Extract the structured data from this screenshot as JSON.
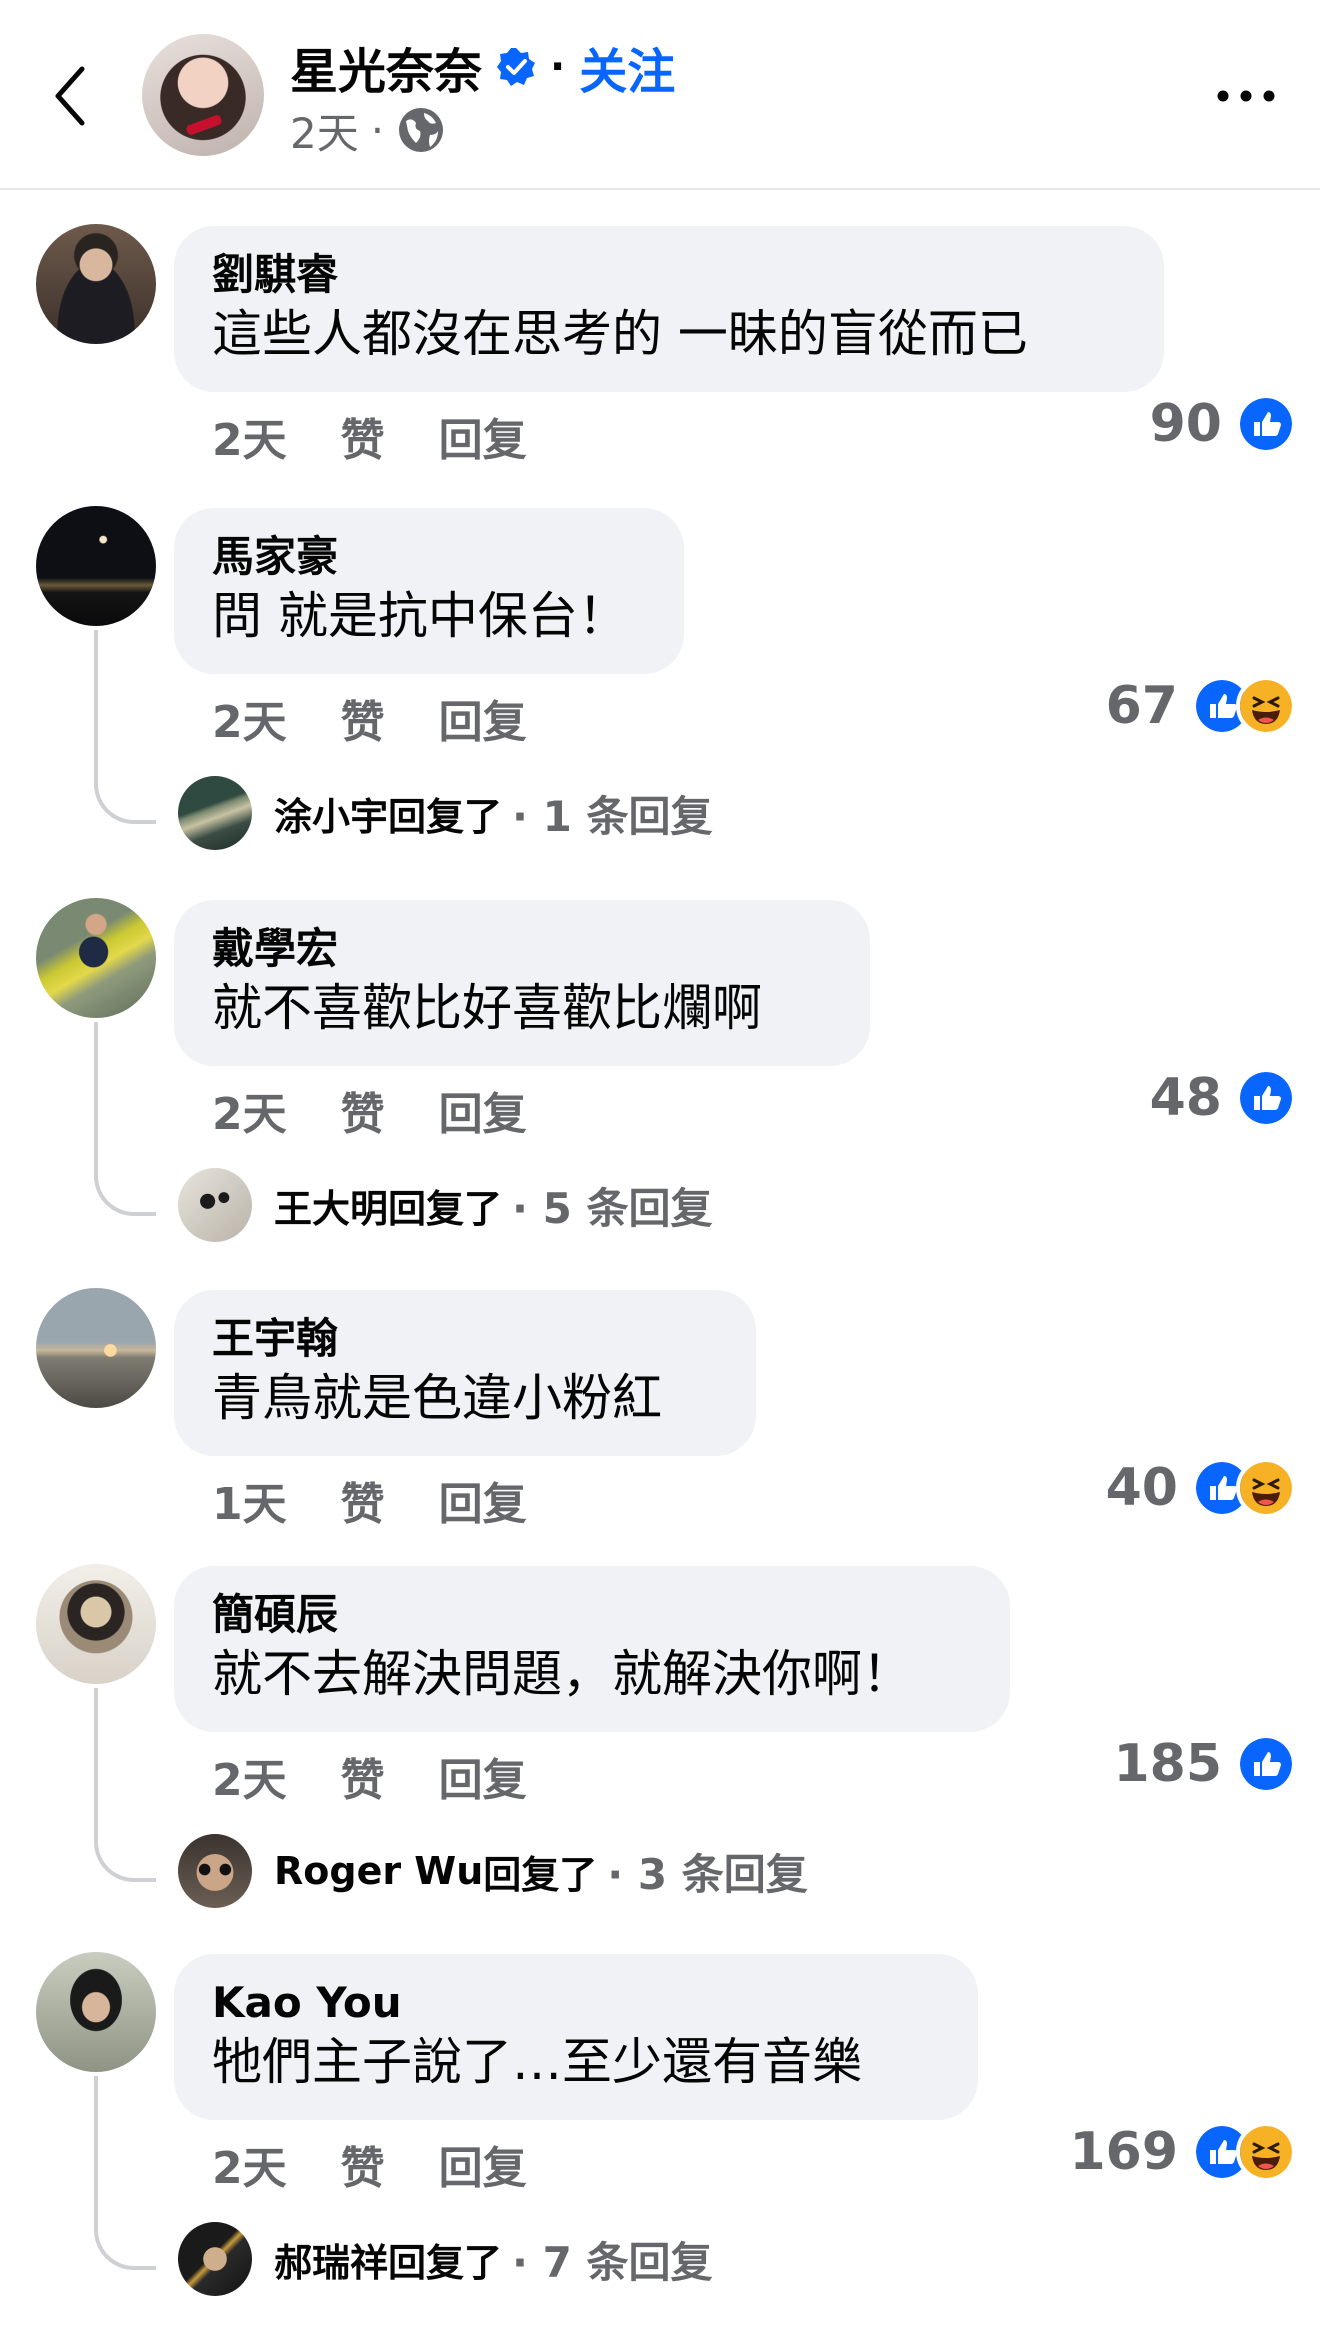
{
  "header": {
    "name": "星光奈奈",
    "separator": "·",
    "follow": "关注",
    "time": "2天",
    "meta_dot": "·"
  },
  "colors": {
    "accent": "#0866ff",
    "bubble": "#f0f2f5",
    "meta": "#65676b",
    "haha": "#f7b125"
  },
  "icons": [
    "chevron-left-icon",
    "verified-badge-icon",
    "globe-icon",
    "more-options-icon",
    "like-reaction-icon",
    "haha-reaction-icon"
  ],
  "comments": [
    {
      "author": "劉騏睿",
      "text": "這些人都沒在思考的 一昧的盲從而已",
      "time": "2天",
      "like": "赞",
      "reply": "回复",
      "count": "90",
      "reactions": [
        "like"
      ]
    },
    {
      "author": "馬家豪",
      "text": "問 就是抗中保台！",
      "time": "2天",
      "like": "赞",
      "reply": "回复",
      "count": "67",
      "reactions": [
        "like",
        "haha"
      ],
      "replies": {
        "name": "涂小宇",
        "suffix": "回复了",
        "count": "· 1 条回复"
      }
    },
    {
      "author": "戴學宏",
      "text": "就不喜歡比好喜歡比爛啊",
      "time": "2天",
      "like": "赞",
      "reply": "回复",
      "count": "48",
      "reactions": [
        "like"
      ],
      "replies": {
        "name": "王大明",
        "suffix": "回复了",
        "count": "· 5 条回复"
      }
    },
    {
      "author": "王宇翰",
      "text": "青鳥就是色違小粉紅",
      "time": "1天",
      "like": "赞",
      "reply": "回复",
      "count": "40",
      "reactions": [
        "like",
        "haha"
      ]
    },
    {
      "author": "簡碩辰",
      "text": "就不去解決問題，就解決你啊！",
      "time": "2天",
      "like": "赞",
      "reply": "回复",
      "count": "185",
      "reactions": [
        "like"
      ],
      "replies": {
        "name": "Roger Wu",
        "suffix": "回复了",
        "count": "· 3 条回复"
      }
    },
    {
      "author": "Kao You",
      "text": "牠們主子說了…至少還有音樂",
      "time": "2天",
      "like": "赞",
      "reply": "回复",
      "count": "169",
      "reactions": [
        "like",
        "haha"
      ],
      "replies": {
        "name": "郝瑞祥",
        "suffix": "回复了",
        "count": "· 7 条回复"
      }
    }
  ]
}
